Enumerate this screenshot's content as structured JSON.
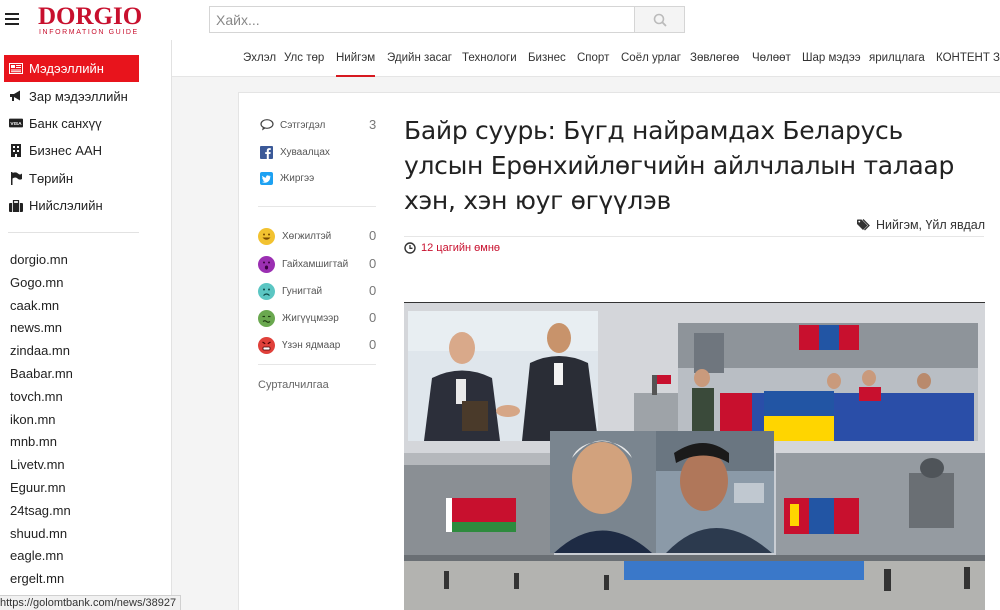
{
  "header": {
    "logo_main": "DORGIO",
    "logo_sub": "INFORMATION GUIDE",
    "search_placeholder": "Хайх..."
  },
  "sidebar": {
    "categories": [
      {
        "label": "Мэдээллийн",
        "icon": "newspaper-icon",
        "active": true
      },
      {
        "label": "Зар мэдээллийн",
        "icon": "megaphone-icon"
      },
      {
        "label": "Банк санхүү",
        "icon": "visa-card-icon"
      },
      {
        "label": "Бизнес ААН",
        "icon": "building-icon"
      },
      {
        "label": "Төрийн",
        "icon": "flag-icon"
      },
      {
        "label": "Нийслэлийн",
        "icon": "briefcase-icon"
      }
    ],
    "sites": [
      "dorgio.mn",
      "Gogo.mn",
      "caak.mn",
      "news.mn",
      "zindaa.mn",
      "Baabar.mn",
      "tovch.mn",
      "ikon.mn",
      "mnb.mn",
      "Livetv.mn",
      "Eguur.mn",
      "24tsag.mn",
      "shuud.mn",
      "eagle.mn",
      "ergelt.mn"
    ]
  },
  "nav": {
    "items": [
      "Эхлэл",
      "Улс төр",
      "Нийгэм",
      "Эдийн засаг",
      "Технологи",
      "Бизнес",
      "Спорт",
      "Соёл урлаг",
      "Зөвлөгөө",
      "Чөлөөт",
      "Шар мэдээ",
      "ярилцлага",
      "КОНТЕНТ ЗА"
    ],
    "active_index": 2
  },
  "share": {
    "comment_label": "Сэтгэгдэл",
    "comment_count": "3",
    "facebook_label": "Хуваалцах",
    "twitter_label": "Жиргээ"
  },
  "reactions": [
    {
      "label": "Хөгжилтэй",
      "count": "0",
      "color": "#f2c230"
    },
    {
      "label": "Гайхамшигтай",
      "count": "0",
      "color": "#9b2fb2"
    },
    {
      "label": "Гунигтай",
      "count": "0",
      "color": "#5bc6c3"
    },
    {
      "label": "Жигүүцмээр",
      "count": "0",
      "color": "#6aa84f"
    },
    {
      "label": "Үзэн ядмаар",
      "count": "0",
      "color": "#e0403a"
    }
  ],
  "related_label": "Сурталчилгаа",
  "article": {
    "title": "Байр суурь: Бүгд найрамдах Беларусь улсын Ерөнхийлөгчийн айлчлалын талаар хэн, хэн юуг өгүүлэв",
    "tags": "Нийгэм, Үйл явдал",
    "time": "12 цагийн өмнө"
  },
  "status_url": "https://golomtbank.com/news/38927",
  "colors": {
    "brand": "#c8102e",
    "active_bg": "#e8141c"
  }
}
